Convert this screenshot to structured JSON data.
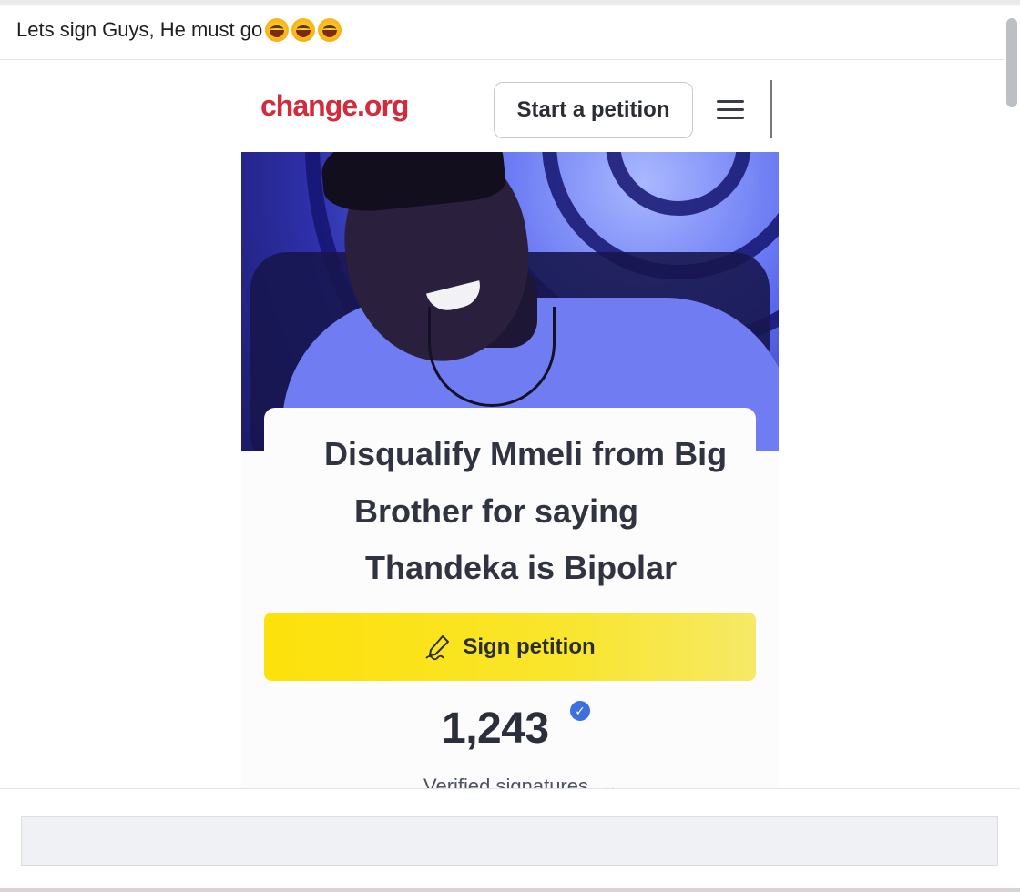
{
  "post": {
    "text": "Lets sign Guys, He must go",
    "emojis": [
      "rolling-on-floor-laughing",
      "rolling-on-floor-laughing",
      "rolling-on-floor-laughing"
    ]
  },
  "screenshot": {
    "logo": "change.org",
    "start_petition_label": "Start a petition",
    "petition_title_lines": [
      "Disqualify Mmeli from Big",
      "Brother for saying",
      "Thandeka is Bipolar"
    ],
    "sign_label": "Sign petition",
    "signature_count": "1,243",
    "verified_label": "Verified signatures",
    "verified_checkmark": "✓",
    "chevron": "⌄"
  },
  "colors": {
    "logo": "#d22b3b",
    "sign_button": "#fde10a",
    "verified_badge": "#3e6fde"
  },
  "composer": {
    "placeholder": ""
  }
}
